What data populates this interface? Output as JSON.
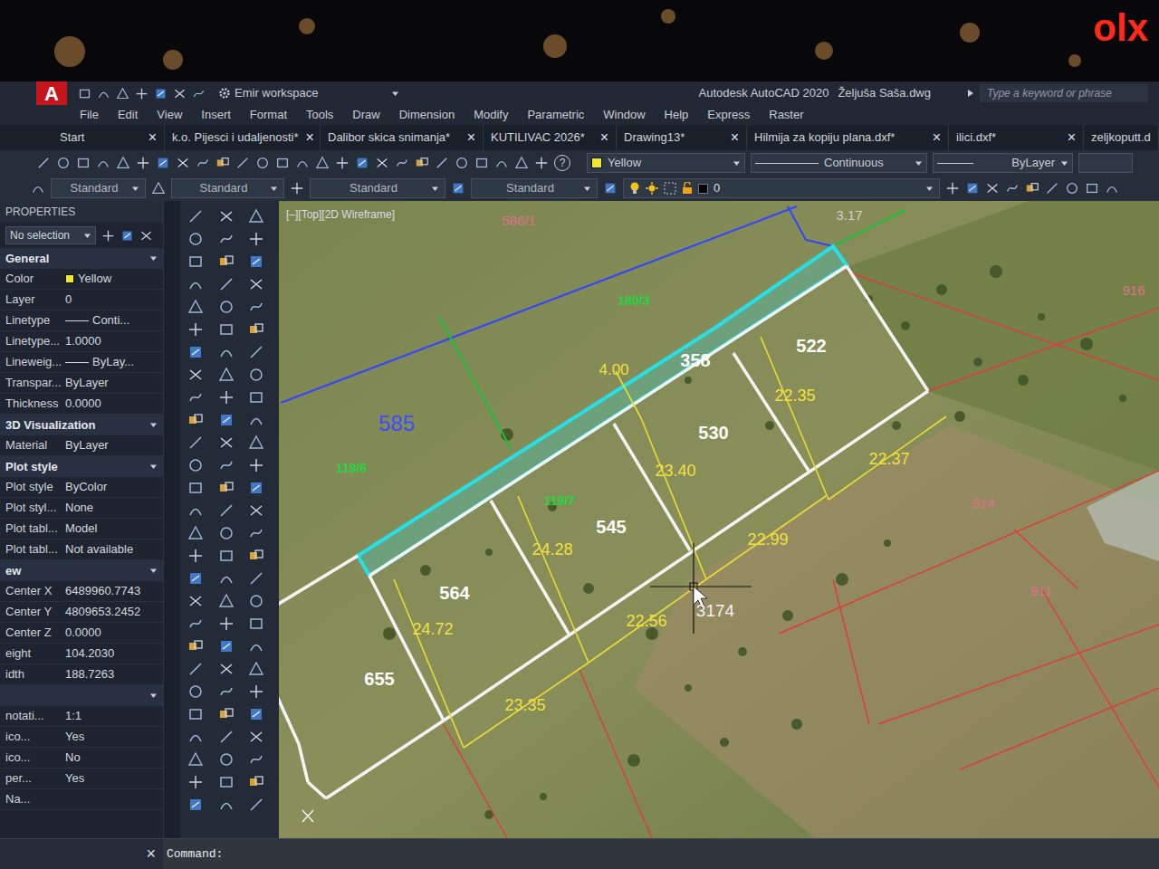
{
  "window": {
    "title": "Autodesk AutoCAD 2020",
    "document": "Željuša Saša.dwg",
    "workspace": "Emir workspace",
    "app_logo": "A"
  },
  "watermark": "olx",
  "search": {
    "placeholder": "Type a keyword or phrase"
  },
  "menu": [
    "File",
    "Edit",
    "View",
    "Insert",
    "Format",
    "Tools",
    "Draw",
    "Dimension",
    "Modify",
    "Parametric",
    "Window",
    "Help",
    "Express",
    "Raster"
  ],
  "tabs": [
    {
      "label": "Start",
      "selected": false
    },
    {
      "label": "k.o. Pijesci i udaljenosti*",
      "selected": false
    },
    {
      "label": "Dalibor skica snimanja*",
      "selected": false
    },
    {
      "label": "KUTILIVAC 2026*",
      "selected": false
    },
    {
      "label": "Drawing13*",
      "selected": false
    },
    {
      "label": "Hilmija za kopiju plana.dxf*",
      "selected": false
    },
    {
      "label": "ilici.dxf*",
      "selected": false
    },
    {
      "label": "zeljkoputt.d",
      "selected": false
    }
  ],
  "tab_close": "×",
  "toolbar": {
    "help": "?",
    "color": "Yellow",
    "color_swatch": "#f2e82a",
    "linetype": "Continuous",
    "lineweight": "ByLayer"
  },
  "styles": {
    "text": "Standard",
    "dimension": "Standard",
    "table": "Standard",
    "multileader": "Standard",
    "layer": "0",
    "layer_color": "#000000"
  },
  "properties": {
    "title": "PROPERTIES",
    "selection": "No selection",
    "sections": [
      {
        "title": "General",
        "rows": [
          {
            "label": "Color",
            "value": "Yellow",
            "kind": "swatch",
            "color": "#f2e82a"
          },
          {
            "label": "Layer",
            "value": "0",
            "kind": "text"
          },
          {
            "label": "Linetype",
            "value": "Conti...",
            "kind": "line"
          },
          {
            "label": "Linetype...",
            "value": "1.0000",
            "kind": "text"
          },
          {
            "label": "Lineweig...",
            "value": "ByLay...",
            "kind": "line"
          },
          {
            "label": "Transpar...",
            "value": "ByLayer",
            "kind": "text"
          },
          {
            "label": "Thickness",
            "value": "0.0000",
            "kind": "text"
          }
        ]
      },
      {
        "title": "3D Visualization",
        "rows": [
          {
            "label": "Material",
            "value": "ByLayer",
            "kind": "text"
          }
        ]
      },
      {
        "title": "Plot style",
        "rows": [
          {
            "label": "Plot style",
            "value": "ByColor",
            "kind": "text"
          },
          {
            "label": "Plot styl...",
            "value": "None",
            "kind": "text"
          },
          {
            "label": "Plot tabl...",
            "value": "Model",
            "kind": "text"
          },
          {
            "label": "Plot tabl...",
            "value": "Not available",
            "kind": "text"
          }
        ]
      },
      {
        "title": "ew",
        "rows": [
          {
            "label": "Center X",
            "value": "6489960.7743",
            "kind": "text"
          },
          {
            "label": "Center Y",
            "value": "4809653.2452",
            "kind": "text"
          },
          {
            "label": "Center Z",
            "value": "0.0000",
            "kind": "text"
          },
          {
            "label": "eight",
            "value": "104.2030",
            "kind": "text"
          },
          {
            "label": "idth",
            "value": "188.7263",
            "kind": "text"
          }
        ]
      },
      {
        "title": "",
        "rows": [
          {
            "label": "notati...",
            "value": "1:1",
            "kind": "text"
          },
          {
            "label": "ico...",
            "value": "Yes",
            "kind": "text"
          },
          {
            "label": "ico...",
            "value": "No",
            "kind": "text"
          },
          {
            "label": "per...",
            "value": "Yes",
            "kind": "text"
          },
          {
            "label": "Na...",
            "value": "",
            "kind": "text"
          }
        ]
      }
    ]
  },
  "viewport_label": "[–][Top][2D Wireframe]",
  "drawing": {
    "labels": [
      {
        "text": "586/1",
        "color": "#e0708a"
      },
      {
        "text": "180/3",
        "color": "#22d640"
      },
      {
        "text": "585",
        "color": "#3b4dff"
      },
      {
        "text": "119/6",
        "color": "#22d640"
      },
      {
        "text": "119/7",
        "color": "#22d640"
      },
      {
        "text": "358",
        "color": "#ffffff"
      },
      {
        "text": "4.00",
        "color": "#f0e040"
      },
      {
        "text": "522",
        "color": "#ffffff"
      },
      {
        "text": "530",
        "color": "#ffffff"
      },
      {
        "text": "545",
        "color": "#ffffff"
      },
      {
        "text": "564",
        "color": "#ffffff"
      },
      {
        "text": "655",
        "color": "#ffffff"
      },
      {
        "text": "22.35",
        "color": "#f0e040"
      },
      {
        "text": "23.40",
        "color": "#f0e040"
      },
      {
        "text": "24.28",
        "color": "#f0e040"
      },
      {
        "text": "24.72",
        "color": "#f0e040"
      },
      {
        "text": "22.37",
        "color": "#f0e040"
      },
      {
        "text": "22.99",
        "color": "#f0e040"
      },
      {
        "text": "22.56",
        "color": "#f0e040"
      },
      {
        "text": "23.35",
        "color": "#f0e040"
      },
      {
        "text": "3174",
        "color": "#f2f2f2"
      },
      {
        "text": "914",
        "color": "#e0708a"
      },
      {
        "text": "916",
        "color": "#e0708a"
      },
      {
        "text": "911",
        "color": "#e0708a"
      },
      {
        "text": "3.17",
        "color": "#d0d0d0"
      }
    ]
  },
  "command": {
    "prompt": "Command:",
    "close": "×"
  }
}
